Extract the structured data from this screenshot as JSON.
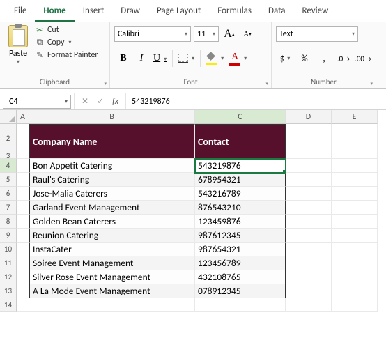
{
  "tabs": {
    "file": "File",
    "home": "Home",
    "insert": "Insert",
    "draw": "Draw",
    "page_layout": "Page Layout",
    "formulas": "Formulas",
    "data": "Data",
    "review": "Review"
  },
  "ribbon": {
    "clipboard": {
      "paste": "Paste",
      "cut": "Cut",
      "copy": "Copy",
      "format_painter": "Format Painter",
      "label": "Clipboard"
    },
    "font": {
      "name": "Calibri",
      "size": "11",
      "label": "Font"
    },
    "number": {
      "format": "Text",
      "label": "Number"
    }
  },
  "namebox": "C4",
  "formula": "543219876",
  "columns": {
    "A": "A",
    "B": "B",
    "C": "C",
    "D": "D",
    "E": "E"
  },
  "header_row": {
    "company": "Company Name",
    "contact": "Contact"
  },
  "data_rows": [
    {
      "n": "4",
      "company": "Bon Appetit Catering",
      "contact": "543219876"
    },
    {
      "n": "5",
      "company": "Raul's Catering",
      "contact": "678954321"
    },
    {
      "n": "6",
      "company": "Jose-Malia Caterers",
      "contact": "543216789"
    },
    {
      "n": "7",
      "company": "Garland Event Management",
      "contact": "876543210"
    },
    {
      "n": "8",
      "company": "Golden Bean Caterers",
      "contact": "123459876"
    },
    {
      "n": "9",
      "company": "Reunion Catering",
      "contact": "987612345"
    },
    {
      "n": "10",
      "company": "InstaCater",
      "contact": "987654321"
    },
    {
      "n": "11",
      "company": "Soiree Event Management",
      "contact": "123456789"
    },
    {
      "n": "12",
      "company": "Silver Rose Event Management",
      "contact": "432108765"
    },
    {
      "n": "13",
      "company": "A La Mode Event Management",
      "contact": "078912345"
    }
  ],
  "empty_row": "14"
}
